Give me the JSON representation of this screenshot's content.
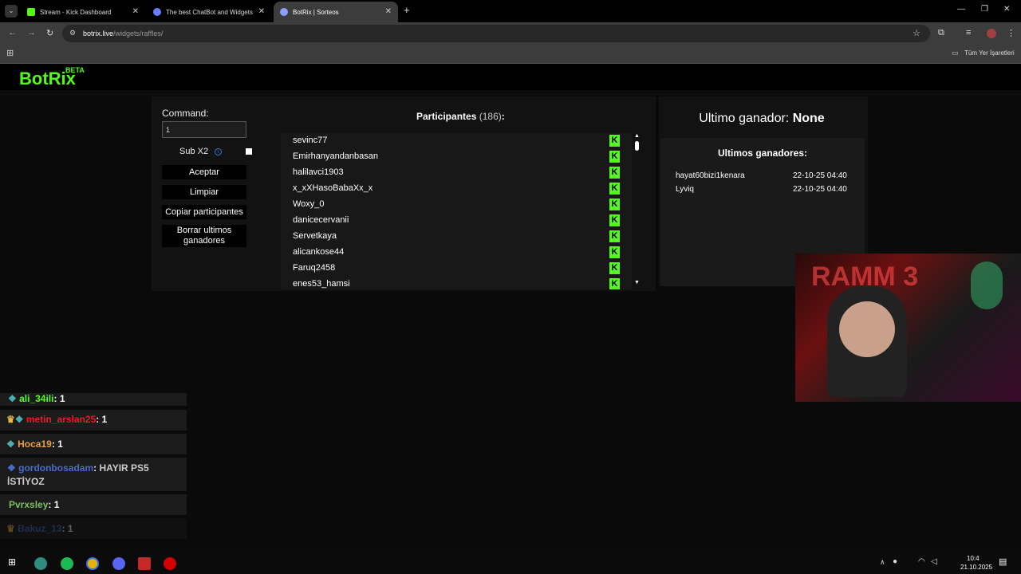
{
  "browser": {
    "tabs": [
      {
        "title": "Stream - Kick Dashboard",
        "icon_color": "#53fc18"
      },
      {
        "title": "The best ChatBot and Widgets",
        "icon_color": "#6a7cff"
      },
      {
        "title": "BotRix | Sorteos",
        "icon_color": "#8aa0ff"
      }
    ],
    "new_tab": "+",
    "url_host": "botrix.live",
    "url_path": "/widgets/raffles/",
    "bookmarks_label": "Tüm Yer İşaretleri"
  },
  "app": {
    "logo": "BotRix",
    "beta": "BETA",
    "command_label": "Command:",
    "command_value": "1",
    "sub_x2_label": "Sub X2",
    "buttons": {
      "accept": "Aceptar",
      "clear": "Limpiar",
      "copy": "Copiar participantes",
      "delete_winners": "Borrar ultimos ganadores"
    },
    "participants_title": "Participantes",
    "participants_count": "(186)",
    "participants_colon": ":",
    "participants": [
      "sevinc77",
      "Emirhanyandanbasan",
      "halilavci1903",
      "x_xXHasoBabaXx_x",
      "Woxy_0",
      "danicecervanii",
      "Servetkaya",
      "alicankose44",
      "Faruq2458",
      "enes53_hamsi"
    ],
    "last_winner_label": "Ultimo ganador:",
    "last_winner_value": "None",
    "last_winners_title": "Ultimos ganadores:",
    "winners": [
      {
        "name": "hayat60bizi1kenara",
        "time": "22-10-25 04:40"
      },
      {
        "name": "Lyviq",
        "time": "22-10-25 04:40"
      }
    ]
  },
  "chat": [
    {
      "user": "ali_34ili",
      "msg": "1",
      "color": "#53fc18"
    },
    {
      "user": "metin_arslan25",
      "msg": "1",
      "color": "#e0202a"
    },
    {
      "user": "Hoca19",
      "msg": "1",
      "color": "#e8a13a"
    },
    {
      "user": "gordonbosadam",
      "msg": "HAYIR PS5 İSTİYOZ",
      "color": "#4a6cc9"
    },
    {
      "user": "Pvrxsley",
      "msg": "1",
      "color": "#7dbf5e"
    },
    {
      "user": "Bakuz_13",
      "msg": "1",
      "color": "#4a6cc9"
    }
  ],
  "taskbar": {
    "clock_time": "10:4",
    "clock_date": "21.10.2025"
  }
}
